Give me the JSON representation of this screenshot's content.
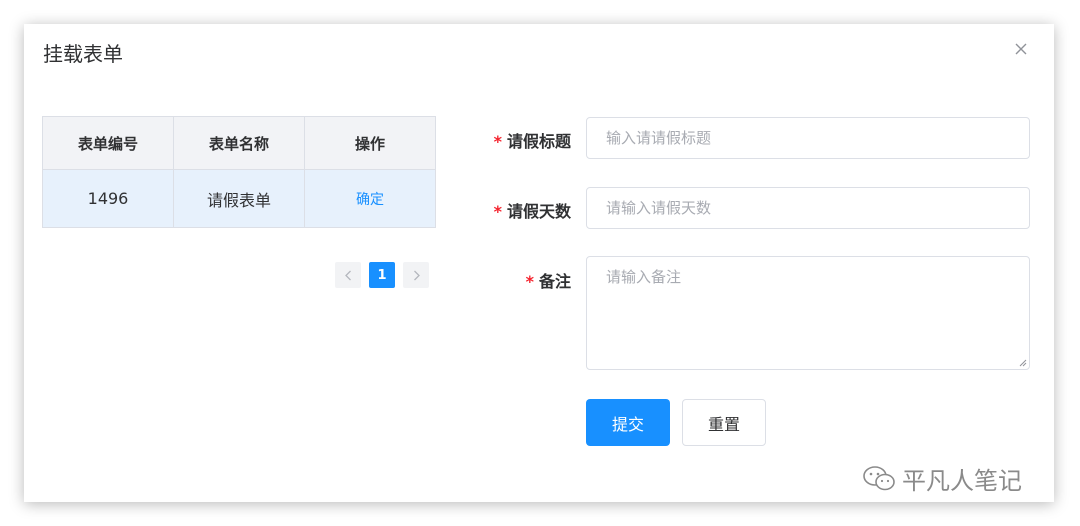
{
  "dialog": {
    "title": "挂载表单",
    "close_icon": "close-icon"
  },
  "table": {
    "columns": [
      "表单编号",
      "表单名称",
      "操作"
    ],
    "rows": [
      {
        "id": "1496",
        "name": "请假表单",
        "action": "确定"
      }
    ],
    "row_highlight_color": "#e7f1fc"
  },
  "pagination": {
    "current_page": "1",
    "prev_icon": "chevron-left-icon",
    "next_icon": "chevron-right-icon"
  },
  "form": {
    "required_mark": "*",
    "fields": [
      {
        "label": "请假标题",
        "placeholder": "输入请请假标题",
        "value": ""
      },
      {
        "label": "请假天数",
        "placeholder": "请输入请假天数",
        "value": ""
      },
      {
        "label": "备注",
        "placeholder": "请输入备注",
        "value": ""
      }
    ],
    "submit_label": "提交",
    "reset_label": "重置"
  },
  "watermark": {
    "text": "平凡人笔记",
    "icon": "wechat-icon"
  },
  "colors": {
    "primary": "#1890ff",
    "required": "#f5222d",
    "border": "#dcdfe6"
  }
}
